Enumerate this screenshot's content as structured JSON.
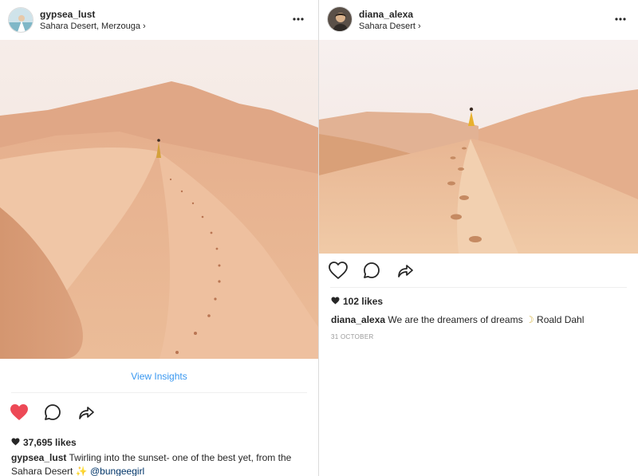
{
  "left_post": {
    "username": "gypsea_lust",
    "location": "Sahara Desert, Merzouga",
    "location_chevron": "›",
    "more_label": "•••",
    "view_insights": "View Insights",
    "liked": true,
    "likes_count": "37,695 likes",
    "caption_user": "gypsea_lust",
    "caption_text": "Twirling into the sunset- one of the best yet, from the",
    "caption_text_2": "Sahara Desert ✨",
    "caption_mention": "@bungeegirl"
  },
  "right_post": {
    "username": "diana_alexa",
    "location": "Sahara Desert",
    "location_chevron": "›",
    "more_label": "•••",
    "liked": false,
    "likes_count": "102 likes",
    "caption_user": "diana_alexa",
    "caption_text": "We are the dreamers of dreams",
    "caption_emoji": "☽",
    "caption_author": "Roald Dahl",
    "date": "31 OCTOBER"
  },
  "icons": {
    "like": "heart-icon",
    "comment": "comment-icon",
    "share": "share-icon",
    "more": "more-icon"
  },
  "colors": {
    "liked_heart": "#ed4956",
    "link": "#3897f0",
    "text": "#262626",
    "muted": "#999999"
  }
}
